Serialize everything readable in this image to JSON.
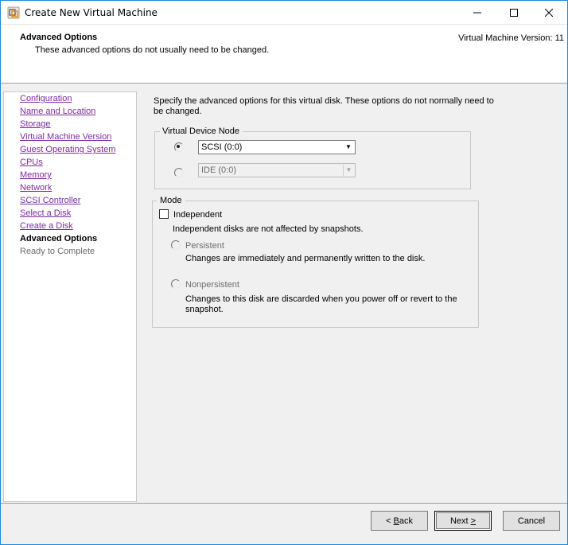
{
  "window": {
    "title": "Create New Virtual Machine",
    "controls": {
      "minimize": "–",
      "maximize": "☐",
      "close": "✕"
    }
  },
  "header": {
    "title": "Advanced Options",
    "subtitle": "These advanced options do not usually need to be changed.",
    "version": "Virtual Machine Version: 11"
  },
  "sidebar": {
    "items": [
      {
        "label": "Configuration",
        "state": "visited"
      },
      {
        "label": "Name and Location",
        "state": "visited"
      },
      {
        "label": "Storage",
        "state": "visited"
      },
      {
        "label": "Virtual Machine Version",
        "state": "visited"
      },
      {
        "label": "Guest Operating System",
        "state": "visited"
      },
      {
        "label": "CPUs",
        "state": "visited"
      },
      {
        "label": "Memory",
        "state": "visited"
      },
      {
        "label": "Network",
        "state": "visited"
      },
      {
        "label": "SCSI Controller",
        "state": "visited"
      },
      {
        "label": "Select a Disk",
        "state": "visited"
      },
      {
        "label": "Create a Disk",
        "state": "visited"
      },
      {
        "label": "Advanced Options",
        "state": "current"
      },
      {
        "label": "Ready to Complete",
        "state": "future"
      }
    ]
  },
  "content": {
    "intro": "Specify the advanced options for this virtual disk. These options do not normally need to be changed.",
    "device_node": {
      "legend": "Virtual Device Node",
      "scsi_value": "SCSI (0:0)",
      "scsi_selected": true,
      "ide_value": "IDE (0:0)",
      "ide_enabled": false
    },
    "mode": {
      "legend": "Mode",
      "independent_label": "Independent",
      "independent_checked": false,
      "independent_desc": "Independent disks are not affected by snapshots.",
      "persistent_label": "Persistent",
      "persistent_desc": "Changes are immediately and permanently written to the disk.",
      "nonpersistent_label": "Nonpersistent",
      "nonpersistent_desc": "Changes to this disk are discarded when you power off or revert to the snapshot."
    }
  },
  "footer": {
    "back": {
      "prefix": "",
      "mnemonic": "B",
      "suffix": "ack",
      "arrow": "< "
    },
    "next": {
      "prefix": "Next ",
      "arrow": ">"
    },
    "cancel": "Cancel"
  },
  "colors": {
    "accent_border": "#1a8ae0",
    "visited_link": "#7b2c9e",
    "disabled_text": "#6d6d6d"
  }
}
